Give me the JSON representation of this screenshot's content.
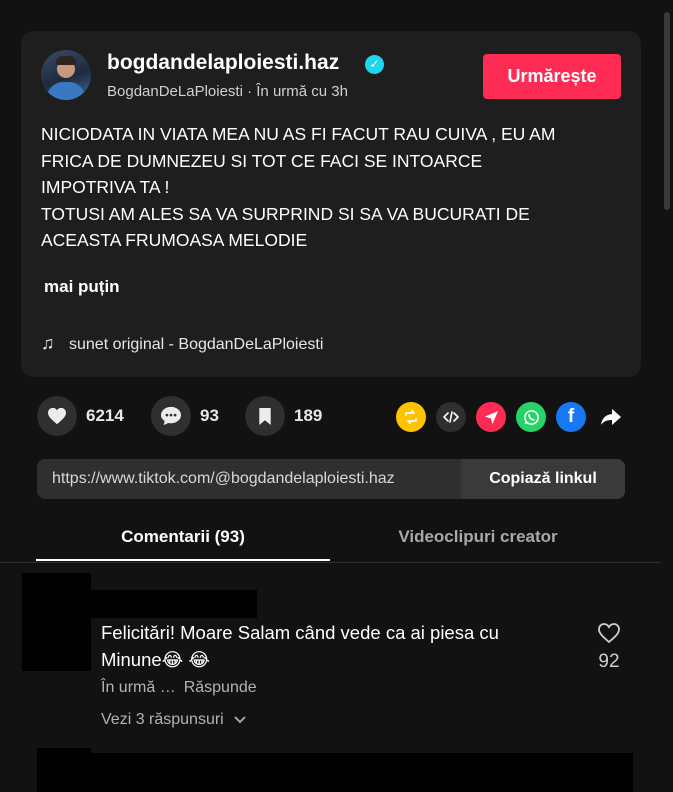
{
  "post": {
    "author": "bogdandelaploiesti.haz",
    "verified_icon": "verified-badge-icon",
    "subline": "BogdanDeLaPloiesti · În urmă cu 3h",
    "follow_label": "Urmărește",
    "caption_lines": [
      "NICIODATA IN VIATA MEA NU AS FI FACUT RAU CUIVA , EU AM",
      "FRICA DE DUMNEZEU SI TOT CE FACI SE INTOARCE",
      "IMPOTRIVA TA !",
      "TOTUSI AM ALES SA VA SURPRIND SI SA VA BUCURATI DE",
      "ACEASTA FRUMOASA MELODIE"
    ],
    "less_label": "mai puțin",
    "sound_label": "sunet original - BogdanDeLaPloiesti"
  },
  "stats": {
    "likes": "6214",
    "comments": "93",
    "saves": "189"
  },
  "share_icons": [
    "repost-icon",
    "embed-icon",
    "send-icon",
    "whatsapp-icon",
    "facebook-icon",
    "share-arrow-icon"
  ],
  "colors": {
    "accent": "#fe2c55",
    "verified": "#20d5ec",
    "repost": "#ffc300",
    "whatsapp": "#25d366",
    "facebook": "#1877f2"
  },
  "link": {
    "url": "https://www.tiktok.com/@bogdandelaploiesti.haz",
    "copy_label": "Copiază linkul"
  },
  "tabs": [
    {
      "label": "Comentarii (93)",
      "active": true
    },
    {
      "label": "Videoclipuri creator",
      "active": false
    }
  ],
  "comments": [
    {
      "text": "Felicitări! Moare Salam când vede ca ai piesa cu Minune😂 😂",
      "time": "În urmă …",
      "reply_label": "Răspunde",
      "likes": "92",
      "view_replies": "Vezi 3 răspunsuri"
    }
  ]
}
